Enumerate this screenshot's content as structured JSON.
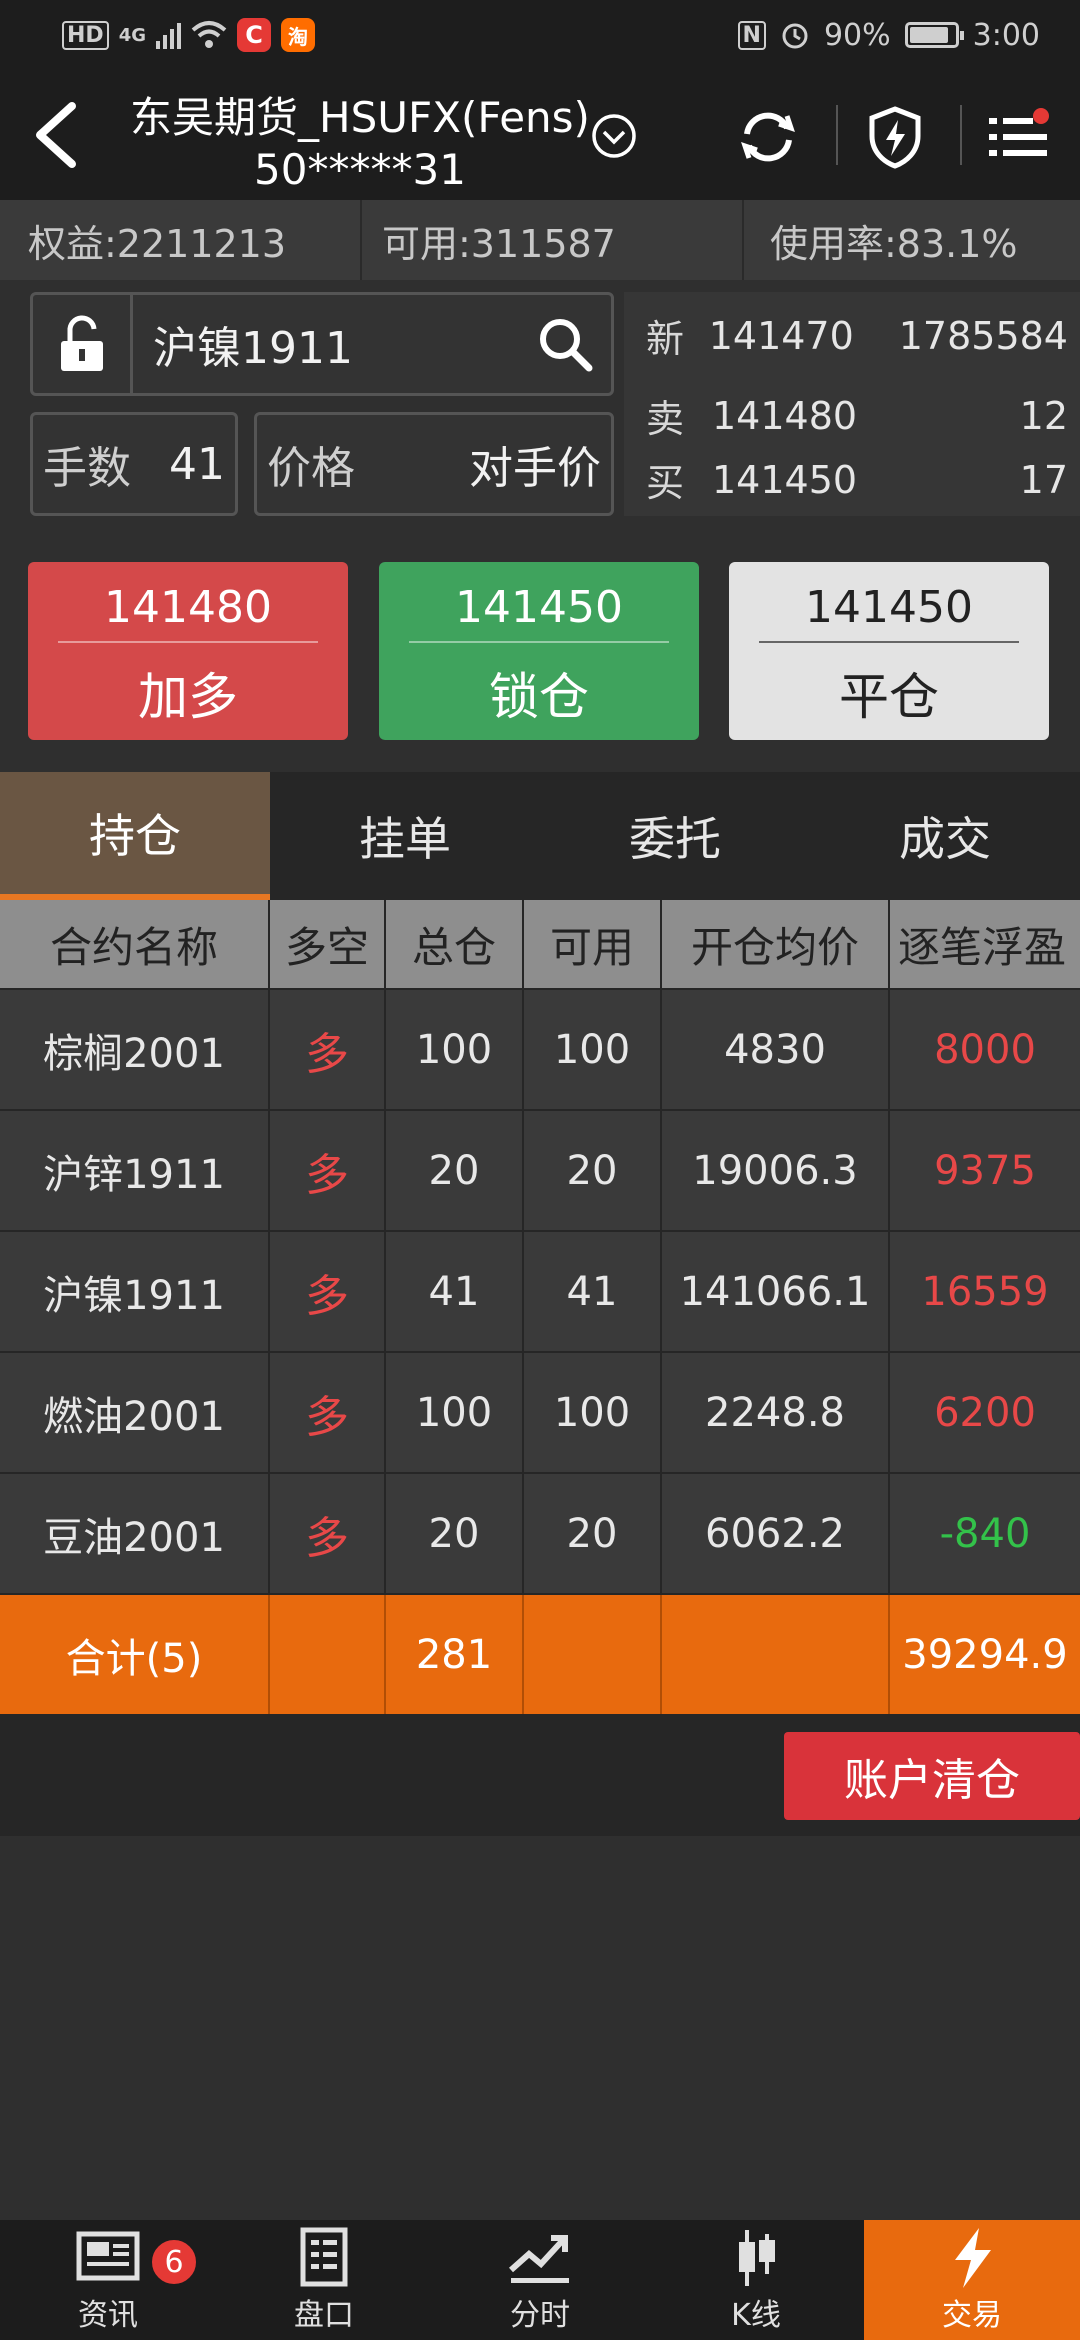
{
  "status_bar": {
    "left": {
      "hd": "HD",
      "network": "4G",
      "app_c": "C",
      "app_tao": "淘"
    },
    "right": {
      "nfc": "N",
      "battery": "90%",
      "time": "3:00"
    }
  },
  "header": {
    "title_line1": "东吴期货_HSUFX(Fens)",
    "title_line2": "50*****31"
  },
  "account": {
    "equity": "权益:2211213",
    "available": "可用:311587",
    "usage": "使用率:83.1%"
  },
  "order_form": {
    "contract": "沪镍1911",
    "qty_label": "手数",
    "qty_value": "41",
    "price_label": "价格",
    "price_value": "对手价"
  },
  "quote": {
    "rows": [
      {
        "label": "新",
        "price": "141470",
        "vol": "1785584"
      },
      {
        "label": "卖",
        "price": "141480",
        "vol": "12"
      },
      {
        "label": "买",
        "price": "141450",
        "vol": "17"
      }
    ]
  },
  "actions": {
    "buy": {
      "price": "141480",
      "label": "加多"
    },
    "lock": {
      "price": "141450",
      "label": "锁仓"
    },
    "close": {
      "price": "141450",
      "label": "平仓"
    }
  },
  "tabs": [
    {
      "label": "持仓"
    },
    {
      "label": "挂单"
    },
    {
      "label": "委托"
    },
    {
      "label": "成交"
    }
  ],
  "table": {
    "headers": [
      "合约名称",
      "多空",
      "总仓",
      "可用",
      "开仓均价",
      "逐笔浮盈"
    ],
    "rows": [
      {
        "name": "棕榈2001",
        "dir": "多",
        "total": "100",
        "avail": "100",
        "avg": "4830",
        "pnl": "8000"
      },
      {
        "name": "沪锌1911",
        "dir": "多",
        "total": "20",
        "avail": "20",
        "avg": "19006.3",
        "pnl": "9375"
      },
      {
        "name": "沪镍1911",
        "dir": "多",
        "total": "41",
        "avail": "41",
        "avg": "141066.1",
        "pnl": "16559"
      },
      {
        "name": "燃油2001",
        "dir": "多",
        "total": "100",
        "avail": "100",
        "avg": "2248.8",
        "pnl": "6200"
      },
      {
        "name": "豆油2001",
        "dir": "多",
        "total": "20",
        "avail": "20",
        "avg": "6062.2",
        "pnl": "-840"
      }
    ],
    "total": {
      "name": "合计(5)",
      "total": "281",
      "pnl": "39294.9"
    }
  },
  "clear_button": "账户清仓",
  "bottom_nav": [
    {
      "label": "资讯",
      "badge": "6"
    },
    {
      "label": "盘口"
    },
    {
      "label": "分时"
    },
    {
      "label": "K线"
    },
    {
      "label": "交易"
    }
  ],
  "colors": {
    "accent": "#e86a0e",
    "buy": "#d4494a",
    "lock": "#3fa35d",
    "profit": "#e84848",
    "loss": "#33c24a"
  }
}
